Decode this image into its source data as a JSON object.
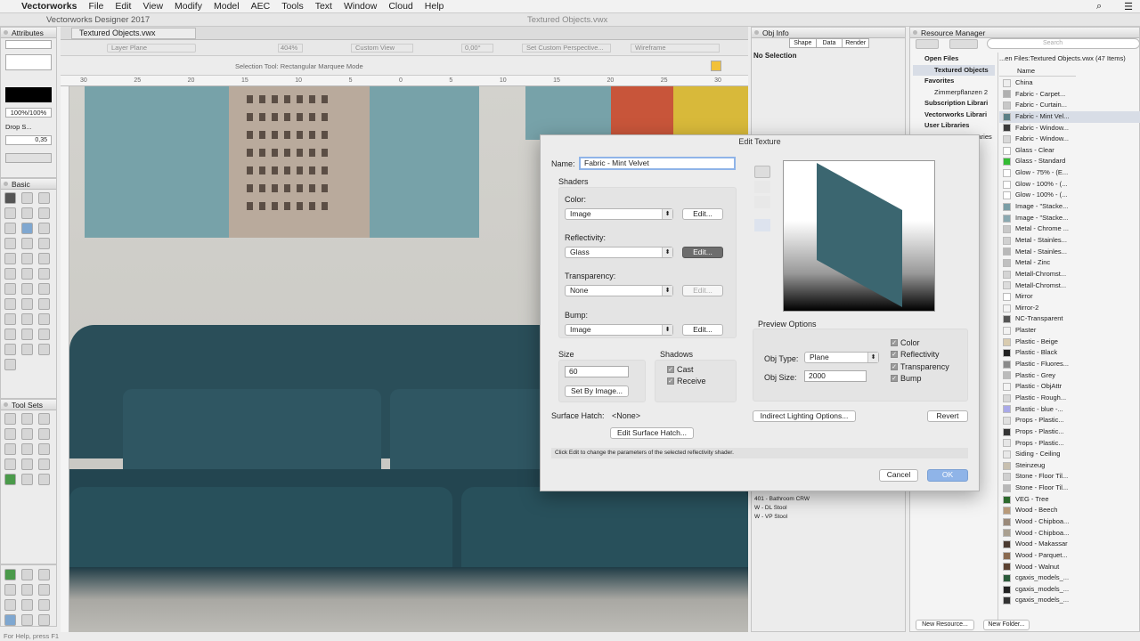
{
  "menubar": {
    "apple": "",
    "app": "Vectorworks",
    "items": [
      "File",
      "Edit",
      "View",
      "Modify",
      "Model",
      "AEC",
      "Tools",
      "Text",
      "Window",
      "Cloud",
      "Help"
    ]
  },
  "titlebar": {
    "app_title": "Vectorworks Designer 2017",
    "doc_title": "Textured Objects.vwx"
  },
  "attributes": {
    "title": "Attributes",
    "opacity": "100%/100%",
    "drop_label": "Drop S...",
    "line_value": "0,35"
  },
  "doc_tab": "Textured Objects.vwx",
  "view_bar": {
    "layer": "Layer Plane",
    "zoom": "404%",
    "view": "Custom View",
    "perspective": "Set Custom Perspective...",
    "render": "Wireframe",
    "angle": "0,00°"
  },
  "mode_bar": {
    "hint": "Selection Tool: Rectangular Marquee Mode"
  },
  "ruler": {
    "marks": [
      "30",
      "25",
      "20",
      "15",
      "10",
      "5",
      "0",
      "5",
      "10",
      "15",
      "20",
      "25",
      "30"
    ]
  },
  "basic": {
    "title": "Basic"
  },
  "toolsets": {
    "title": "Tool Sets"
  },
  "status": {
    "help": "For Help, press F1"
  },
  "obj_info": {
    "title": "Obj Info",
    "tabs": [
      "Shape",
      "Data",
      "Render"
    ],
    "no_selection": "No Selection",
    "rows": [
      "401 - Bathroom CRW",
      "W - DL Stool",
      "W - VP Stool"
    ]
  },
  "resource_manager": {
    "title": "Resource Manager",
    "search_placeholder": "Search",
    "tree": [
      {
        "label": "Open Files",
        "bold": true
      },
      {
        "label": "Textured Objects",
        "bold": true
      },
      {
        "label": "Favorites",
        "bold": true
      },
      {
        "label": "Zimmerpflanzen 2",
        "bold": false
      },
      {
        "label": "Subscription Librari",
        "bold": true
      },
      {
        "label": "Vectorworks Librari",
        "bold": true
      },
      {
        "label": "User Libraries",
        "bold": true
      },
      {
        "label": "raries",
        "bold": false
      }
    ],
    "path": "...en Files:Textured Objects.vwx",
    "count": "(47 Items)",
    "col_name": "Name",
    "items": [
      {
        "name": "China",
        "color": "#eeeeee"
      },
      {
        "name": "Fabric - Carpet...",
        "color": "#b0b0b0"
      },
      {
        "name": "Fabric - Curtain...",
        "color": "#c8c8c8"
      },
      {
        "name": "Fabric - Mint Vel...",
        "color": "#5a7f86"
      },
      {
        "name": "Fabric - Window...",
        "color": "#3a3a3a"
      },
      {
        "name": "Fabric - Window...",
        "color": "#d8d8d8"
      },
      {
        "name": "Glass - Clear",
        "color": "#ffffff"
      },
      {
        "name": "Glass - Standard",
        "color": "#33bb33"
      },
      {
        "name": "Glow - 75% - (E...",
        "color": "#ffffff"
      },
      {
        "name": "Glow - 100% - (...",
        "color": "#ffffff"
      },
      {
        "name": "Glow - 100% - (...",
        "color": "#ffffff"
      },
      {
        "name": "Image - \"Stacke...",
        "color": "#7a9ea6"
      },
      {
        "name": "Image - \"Stacke...",
        "color": "#8aa8b0"
      },
      {
        "name": "Metal - Chrome ...",
        "color": "#c8c8c8"
      },
      {
        "name": "Metal - Stainles...",
        "color": "#d0d0d0"
      },
      {
        "name": "Metal - Stainles...",
        "color": "#b8b8b8"
      },
      {
        "name": "Metal - Zinc",
        "color": "#c0c0c0"
      },
      {
        "name": "Metall-Chromst...",
        "color": "#d4d4d4"
      },
      {
        "name": "Metall-Chromst...",
        "color": "#dcdcdc"
      },
      {
        "name": "Mirror",
        "color": "#ffffff"
      },
      {
        "name": "Mirror-2",
        "color": "#f4f4f4"
      },
      {
        "name": "NC-Transparent",
        "color": "#555555"
      },
      {
        "name": "Plaster",
        "color": "#f2f2f2"
      },
      {
        "name": "Plastic - Beige",
        "color": "#d9ccb0"
      },
      {
        "name": "Plastic - Black",
        "color": "#222222"
      },
      {
        "name": "Plastic - Fluores...",
        "color": "#8a8a8a"
      },
      {
        "name": "Plastic - Grey",
        "color": "#bbbbbb"
      },
      {
        "name": "Plastic - ObjAttr",
        "color": "#f4f4f4"
      },
      {
        "name": "Plastic - Rough...",
        "color": "#d8d8d8"
      },
      {
        "name": "Plastic - blue -...",
        "color": "#a9a9e8"
      },
      {
        "name": "Props - Plastic...",
        "color": "#e0e0e0"
      },
      {
        "name": "Props - Plastic...",
        "color": "#333333"
      },
      {
        "name": "Props - Plastic...",
        "color": "#e6e6e6"
      },
      {
        "name": "Siding - Ceiling",
        "color": "#e8e8e8"
      },
      {
        "name": "Steinzeug",
        "color": "#c8c0b0"
      },
      {
        "name": "Stone - Floor Til...",
        "color": "#d0d0d0"
      },
      {
        "name": "Stone - Floor Til...",
        "color": "#b8b8b8"
      },
      {
        "name": "VEG - Tree",
        "color": "#2d6a2d"
      },
      {
        "name": "Wood - Beech",
        "color": "#b89a7a"
      },
      {
        "name": "Wood - Chipboa...",
        "color": "#9a8a7a"
      },
      {
        "name": "Wood - Chipboa...",
        "color": "#aaa090"
      },
      {
        "name": "Wood - Makassar",
        "color": "#4a3a30"
      },
      {
        "name": "Wood - Parquet...",
        "color": "#8a6a50"
      },
      {
        "name": "Wood - Walnut",
        "color": "#5a4030"
      },
      {
        "name": "cgaxis_models_...",
        "color": "#2a5a3a"
      },
      {
        "name": "cgaxis_models_...",
        "color": "#222222"
      },
      {
        "name": "cgaxis_models_...",
        "color": "#333333"
      }
    ],
    "new_resource": "New Resource...",
    "new_folder": "New Folder..."
  },
  "dialog": {
    "title": "Edit Texture",
    "name_label": "Name:",
    "name_value": "Fabric - Mint Velvet",
    "shaders_label": "Shaders",
    "color_label": "Color:",
    "color_value": "Image",
    "color_edit": "Edit...",
    "reflect_label": "Reflectivity:",
    "reflect_value": "Glass",
    "reflect_edit": "Edit...",
    "transp_label": "Transparency:",
    "transp_value": "None",
    "transp_edit": "Edit...",
    "bump_label": "Bump:",
    "bump_value": "Image",
    "bump_edit": "Edit...",
    "size_label": "Size",
    "size_value": "60",
    "set_by_image": "Set By Image...",
    "shadows_label": "Shadows",
    "cast": "Cast",
    "receive": "Receive",
    "surface_hatch_label": "Surface Hatch:",
    "surface_hatch_value": "<None>",
    "edit_surface_hatch": "Edit Surface Hatch...",
    "hint": "Click Edit to change the parameters of the selected reflectivity shader.",
    "preview_options": "Preview Options",
    "obj_type_label": "Obj Type:",
    "obj_type_value": "Plane",
    "obj_size_label": "Obj Size:",
    "obj_size_value": "2000",
    "opt_color": "Color",
    "opt_reflectivity": "Reflectivity",
    "opt_transparency": "Transparency",
    "opt_bump": "Bump",
    "indirect": "Indirect Lighting Options...",
    "revert": "Revert",
    "cancel": "Cancel",
    "ok": "OK"
  },
  "colors": {
    "sofa": "#2a4e59",
    "poster": "#77a2a9",
    "accent": "#8fb4e8"
  }
}
